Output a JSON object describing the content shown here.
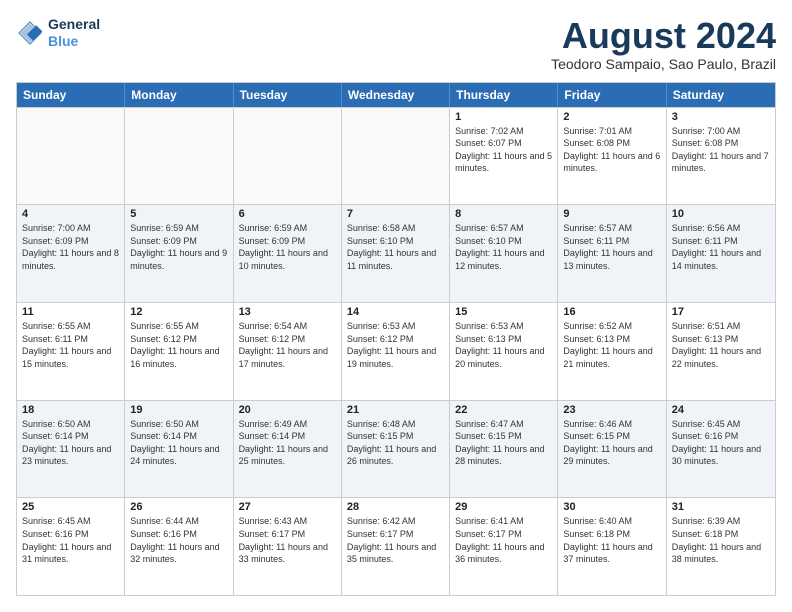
{
  "logo": {
    "line1": "General",
    "line2": "Blue"
  },
  "title": "August 2024",
  "subtitle": "Teodoro Sampaio, Sao Paulo, Brazil",
  "headers": [
    "Sunday",
    "Monday",
    "Tuesday",
    "Wednesday",
    "Thursday",
    "Friday",
    "Saturday"
  ],
  "rows": [
    [
      {
        "day": "",
        "text": "",
        "empty": true
      },
      {
        "day": "",
        "text": "",
        "empty": true
      },
      {
        "day": "",
        "text": "",
        "empty": true
      },
      {
        "day": "",
        "text": "",
        "empty": true
      },
      {
        "day": "1",
        "text": "Sunrise: 7:02 AM\nSunset: 6:07 PM\nDaylight: 11 hours and 5 minutes.",
        "empty": false
      },
      {
        "day": "2",
        "text": "Sunrise: 7:01 AM\nSunset: 6:08 PM\nDaylight: 11 hours and 6 minutes.",
        "empty": false
      },
      {
        "day": "3",
        "text": "Sunrise: 7:00 AM\nSunset: 6:08 PM\nDaylight: 11 hours and 7 minutes.",
        "empty": false
      }
    ],
    [
      {
        "day": "4",
        "text": "Sunrise: 7:00 AM\nSunset: 6:09 PM\nDaylight: 11 hours and 8 minutes.",
        "empty": false
      },
      {
        "day": "5",
        "text": "Sunrise: 6:59 AM\nSunset: 6:09 PM\nDaylight: 11 hours and 9 minutes.",
        "empty": false
      },
      {
        "day": "6",
        "text": "Sunrise: 6:59 AM\nSunset: 6:09 PM\nDaylight: 11 hours and 10 minutes.",
        "empty": false
      },
      {
        "day": "7",
        "text": "Sunrise: 6:58 AM\nSunset: 6:10 PM\nDaylight: 11 hours and 11 minutes.",
        "empty": false
      },
      {
        "day": "8",
        "text": "Sunrise: 6:57 AM\nSunset: 6:10 PM\nDaylight: 11 hours and 12 minutes.",
        "empty": false
      },
      {
        "day": "9",
        "text": "Sunrise: 6:57 AM\nSunset: 6:11 PM\nDaylight: 11 hours and 13 minutes.",
        "empty": false
      },
      {
        "day": "10",
        "text": "Sunrise: 6:56 AM\nSunset: 6:11 PM\nDaylight: 11 hours and 14 minutes.",
        "empty": false
      }
    ],
    [
      {
        "day": "11",
        "text": "Sunrise: 6:55 AM\nSunset: 6:11 PM\nDaylight: 11 hours and 15 minutes.",
        "empty": false
      },
      {
        "day": "12",
        "text": "Sunrise: 6:55 AM\nSunset: 6:12 PM\nDaylight: 11 hours and 16 minutes.",
        "empty": false
      },
      {
        "day": "13",
        "text": "Sunrise: 6:54 AM\nSunset: 6:12 PM\nDaylight: 11 hours and 17 minutes.",
        "empty": false
      },
      {
        "day": "14",
        "text": "Sunrise: 6:53 AM\nSunset: 6:12 PM\nDaylight: 11 hours and 19 minutes.",
        "empty": false
      },
      {
        "day": "15",
        "text": "Sunrise: 6:53 AM\nSunset: 6:13 PM\nDaylight: 11 hours and 20 minutes.",
        "empty": false
      },
      {
        "day": "16",
        "text": "Sunrise: 6:52 AM\nSunset: 6:13 PM\nDaylight: 11 hours and 21 minutes.",
        "empty": false
      },
      {
        "day": "17",
        "text": "Sunrise: 6:51 AM\nSunset: 6:13 PM\nDaylight: 11 hours and 22 minutes.",
        "empty": false
      }
    ],
    [
      {
        "day": "18",
        "text": "Sunrise: 6:50 AM\nSunset: 6:14 PM\nDaylight: 11 hours and 23 minutes.",
        "empty": false
      },
      {
        "day": "19",
        "text": "Sunrise: 6:50 AM\nSunset: 6:14 PM\nDaylight: 11 hours and 24 minutes.",
        "empty": false
      },
      {
        "day": "20",
        "text": "Sunrise: 6:49 AM\nSunset: 6:14 PM\nDaylight: 11 hours and 25 minutes.",
        "empty": false
      },
      {
        "day": "21",
        "text": "Sunrise: 6:48 AM\nSunset: 6:15 PM\nDaylight: 11 hours and 26 minutes.",
        "empty": false
      },
      {
        "day": "22",
        "text": "Sunrise: 6:47 AM\nSunset: 6:15 PM\nDaylight: 11 hours and 28 minutes.",
        "empty": false
      },
      {
        "day": "23",
        "text": "Sunrise: 6:46 AM\nSunset: 6:15 PM\nDaylight: 11 hours and 29 minutes.",
        "empty": false
      },
      {
        "day": "24",
        "text": "Sunrise: 6:45 AM\nSunset: 6:16 PM\nDaylight: 11 hours and 30 minutes.",
        "empty": false
      }
    ],
    [
      {
        "day": "25",
        "text": "Sunrise: 6:45 AM\nSunset: 6:16 PM\nDaylight: 11 hours and 31 minutes.",
        "empty": false
      },
      {
        "day": "26",
        "text": "Sunrise: 6:44 AM\nSunset: 6:16 PM\nDaylight: 11 hours and 32 minutes.",
        "empty": false
      },
      {
        "day": "27",
        "text": "Sunrise: 6:43 AM\nSunset: 6:17 PM\nDaylight: 11 hours and 33 minutes.",
        "empty": false
      },
      {
        "day": "28",
        "text": "Sunrise: 6:42 AM\nSunset: 6:17 PM\nDaylight: 11 hours and 35 minutes.",
        "empty": false
      },
      {
        "day": "29",
        "text": "Sunrise: 6:41 AM\nSunset: 6:17 PM\nDaylight: 11 hours and 36 minutes.",
        "empty": false
      },
      {
        "day": "30",
        "text": "Sunrise: 6:40 AM\nSunset: 6:18 PM\nDaylight: 11 hours and 37 minutes.",
        "empty": false
      },
      {
        "day": "31",
        "text": "Sunrise: 6:39 AM\nSunset: 6:18 PM\nDaylight: 11 hours and 38 minutes.",
        "empty": false
      }
    ]
  ]
}
